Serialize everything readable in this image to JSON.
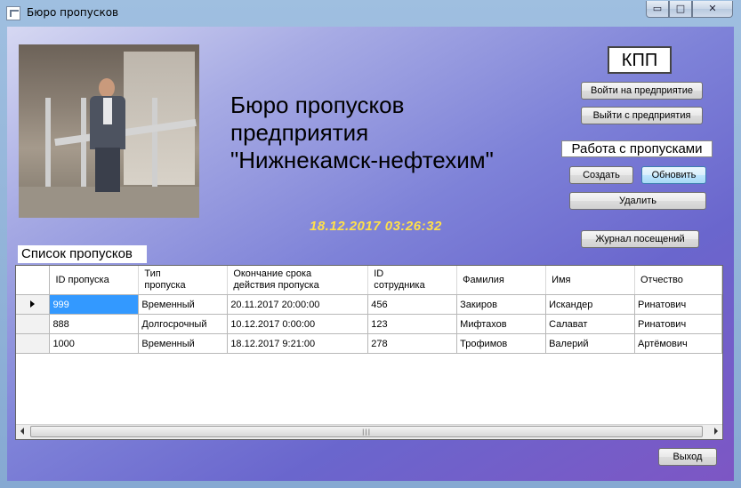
{
  "window": {
    "title": "Бюро пропусков",
    "min_label": "▭",
    "max_label": "□",
    "close_label": "✕"
  },
  "heading": "Бюро пропусков\nпредприятия\n\"Нижнекамск-нефтехим\"",
  "clock": "18.12.2017 03:26:32",
  "checkpoint": {
    "label": "КПП",
    "enter_button": "Войти на предприятие",
    "exit_button": "Выйти с предприятия"
  },
  "passes": {
    "label": "Работа с пропусками",
    "create_button": "Создать",
    "refresh_button": "Обновить",
    "delete_button": "Удалить"
  },
  "journal_button": "Журнал посещений",
  "list_title": "Список пропусков",
  "table": {
    "columns": [
      "ID пропуска",
      "Тип\nпропуска",
      "Окончание срока\nдействия пропуска",
      "ID\nсотрудника",
      "Фамилия",
      "Имя",
      "Отчество"
    ],
    "rows": [
      [
        "999",
        "Временный",
        "20.11.2017 20:00:00",
        "456",
        "Закиров",
        "Искандер",
        "Ринатович"
      ],
      [
        "888",
        "Долгосрочный",
        "10.12.2017 0:00:00",
        "123",
        "Мифтахов",
        "Салават",
        "Ринатович"
      ],
      [
        "1000",
        "Временный",
        "18.12.2017 9:21:00",
        "278",
        "Трофимов",
        "Валерий",
        "Артёмович"
      ]
    ]
  },
  "exit_button": "Выход",
  "colors": {
    "clock": "#ffe04a",
    "selection": "#3399ff"
  }
}
